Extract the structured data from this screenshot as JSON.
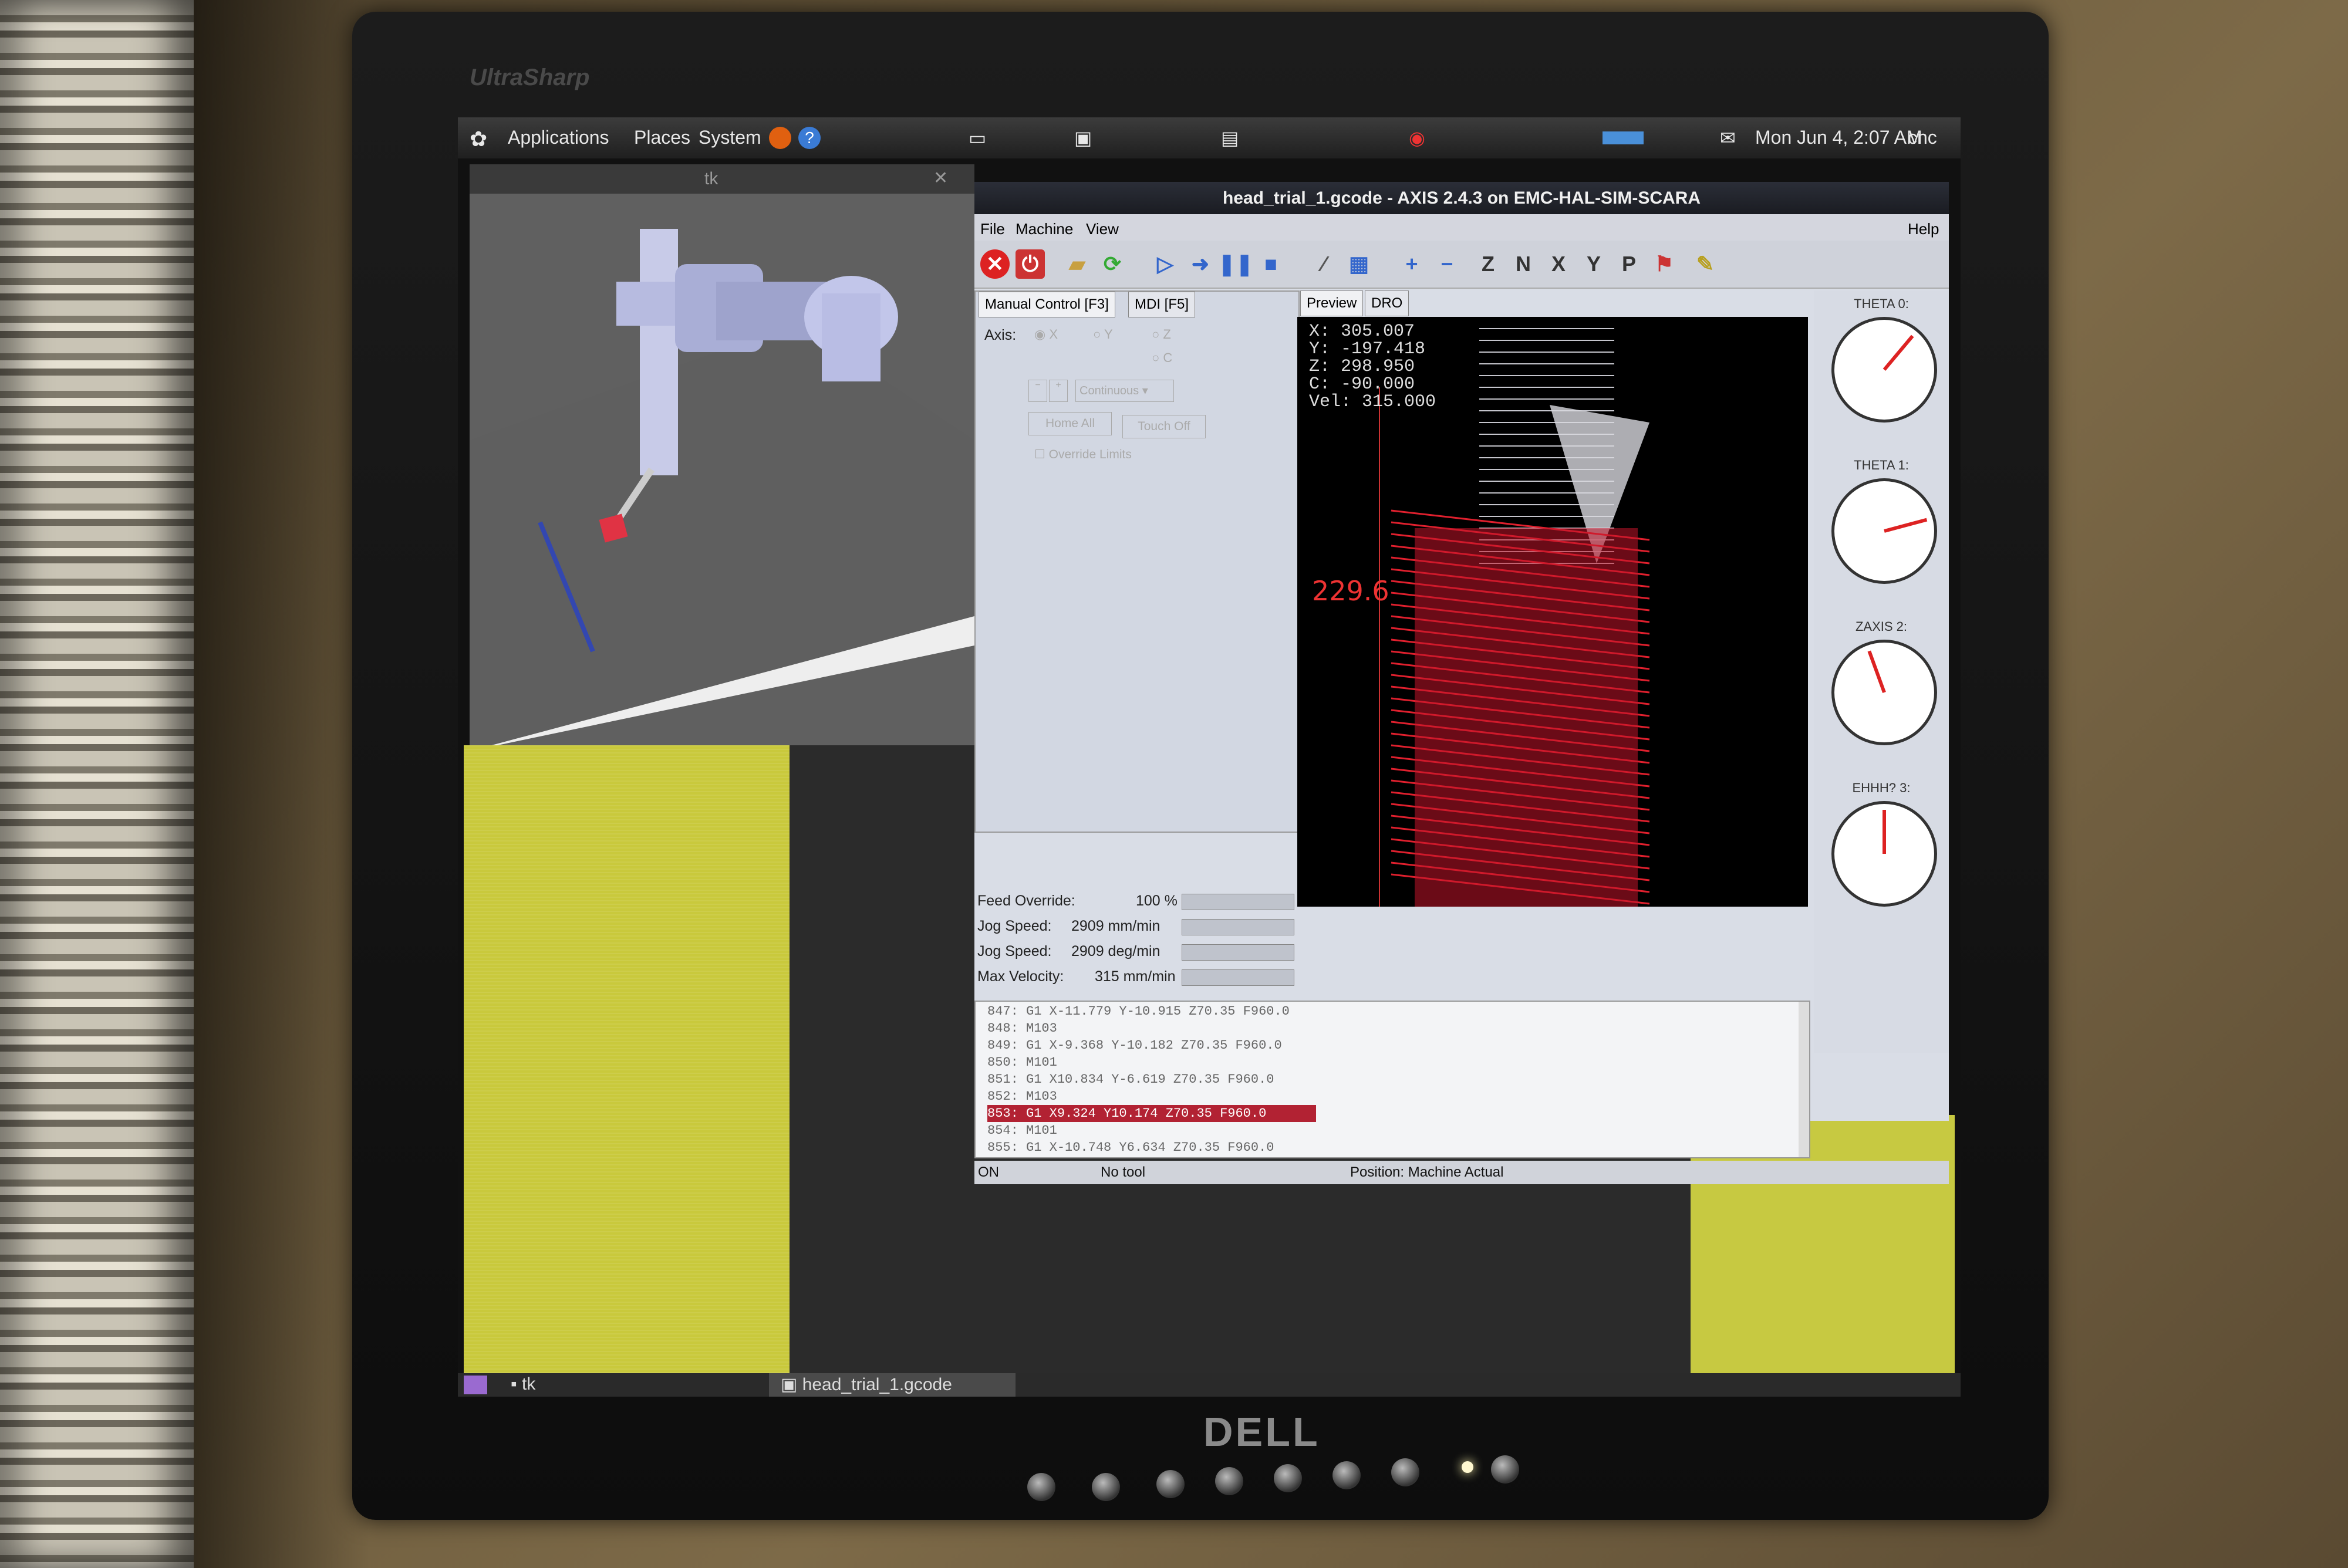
{
  "monitor": {
    "brand_top": "UltraSharp",
    "brand_bottom": "DELL"
  },
  "panel": {
    "menus": [
      "Applications",
      "Places",
      "System"
    ],
    "clock": "Mon Jun 4, 2:07 AM",
    "user": "cnc"
  },
  "tk_window": {
    "title": "tk"
  },
  "axis": {
    "title": "head_trial_1.gcode - AXIS 2.4.3 on EMC-HAL-SIM-SCARA",
    "menu": [
      "File",
      "Machine",
      "View"
    ],
    "help": "Help",
    "toolbar_letters": [
      "Z",
      "N",
      "X",
      "Y",
      "P"
    ],
    "tabs": {
      "manual": "Manual Control [F3]",
      "mdi": "MDI [F5]",
      "preview": "Preview",
      "dro": "DRO"
    },
    "manual": {
      "axis_label": "Axis:",
      "axes": [
        "X",
        "Y",
        "Z",
        "C"
      ],
      "jog_mode": "Continuous",
      "home_all": "Home All",
      "touch_off": "Touch Off",
      "override_limits": "Override Limits"
    },
    "dro": {
      "x_label": "X:",
      "x": "305.007",
      "y_label": "Y:",
      "y": "-197.418",
      "z_label": "Z:",
      "z": "298.950",
      "c_label": "C:",
      "c": "-90.000",
      "vel_label": "Vel:",
      "vel": "315.000"
    },
    "preview_label": "229.6",
    "sliders": [
      {
        "label": "Feed Override:",
        "value": "100 %"
      },
      {
        "label": "Jog Speed:",
        "value": "2909 mm/min"
      },
      {
        "label": "Jog Speed:",
        "value": "2909 deg/min"
      },
      {
        "label": "Max Velocity:",
        "value": "315 mm/min"
      }
    ],
    "gcode": [
      "847: G1 X-11.779 Y-10.915 Z70.35 F960.0",
      "848: M103",
      "849: G1 X-9.368 Y-10.182 Z70.35 F960.0",
      "850: M101",
      "851: G1 X10.834 Y-6.619 Z70.35 F960.0",
      "852: M103",
      "853: G1 X9.324 Y10.174 Z70.35 F960.0",
      "854: M101",
      "855: G1 X-10.748 Y6.634 Z70.35 F960.0"
    ],
    "gcode_active_index": 6,
    "status": {
      "state": "ON",
      "tool": "No tool",
      "position": "Position: Machine Actual"
    },
    "gauges": [
      {
        "label": "THETA 0:",
        "value_deg": 40
      },
      {
        "label": "THETA 1:",
        "value_deg": 75
      },
      {
        "label": "ZAXIS 2:",
        "value_deg": -20
      },
      {
        "label": "EHHH? 3:",
        "value_deg": 0
      }
    ]
  },
  "taskbar": {
    "tk": "tk",
    "active": "head_trial_1.gcode"
  }
}
